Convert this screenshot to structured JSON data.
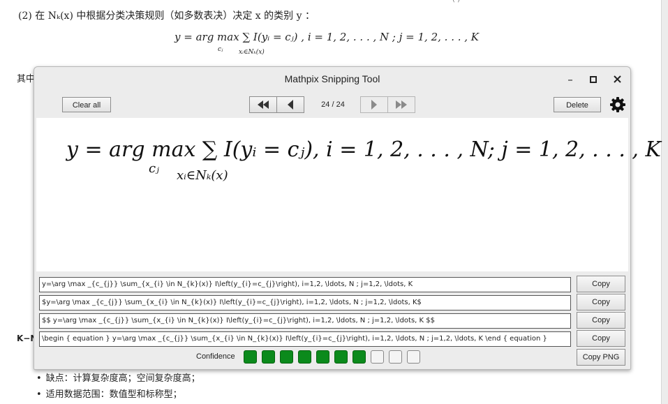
{
  "document": {
    "line1": "(2) 在 Nₖ(x) 中根据分类决策规则（如多数表决）决定 x 的类别 y ：",
    "formula": "y = arg max  ∑  I(yᵢ = cⱼ) ,  i = 1, 2, . . . , N ;  j = 1, 2, . . . , K",
    "formula_sub_c": "cⱼ",
    "formula_sub_sum": "xᵢ∈Nₖ(x)",
    "qizhong": "其中",
    "kn": "K−N",
    "top_fragment": "( )",
    "bullets": [
      "缺点：计算复杂度高；空间复杂度高；",
      "适用数据范围：数值型和标称型；"
    ]
  },
  "window": {
    "title": "Mathpix Snipping Tool",
    "minimize": "–",
    "maximize": "□",
    "close": "✕",
    "clear_all": "Clear all",
    "counter": "24 / 24",
    "delete": "Delete",
    "preview_math": "y = arg max  ∑  I(yᵢ = cⱼ), i = 1, 2, . . . , N; j = 1, 2, . . . , K",
    "preview_sub_c": "cⱼ",
    "preview_sub_sum": "xᵢ∈Nₖ(x)",
    "rows": [
      {
        "latex": "y=\\arg \\max _{c_{j}} \\sum_{x_{i} \\in N_{k}(x)} I\\left(y_{i}=c_{j}\\right), i=1,2, \\ldots, N ; j=1,2, \\ldots, K",
        "copy": "Copy"
      },
      {
        "latex": "$y=\\arg \\max _{c_{j}} \\sum_{x_{i} \\in N_{k}(x)} I\\left(y_{i}=c_{j}\\right), i=1,2, \\ldots, N ; j=1,2, \\ldots, K$",
        "copy": "Copy"
      },
      {
        "latex": "$$ y=\\arg \\max _{c_{j}} \\sum_{x_{i} \\in N_{k}(x)} I\\left(y_{i}=c_{j}\\right), i=1,2, \\ldots, N ; j=1,2, \\ldots, K $$",
        "copy": "Copy"
      },
      {
        "latex": "\\begin { equation } y=\\arg \\max _{c_{j}} \\sum_{x_{i} \\in N_{k}(x)} I\\left(y_{i}=c_{j}\\right), i=1,2, \\ldots, N ; j=1,2, \\ldots, K \\end { equation }",
        "copy": "Copy"
      }
    ],
    "confidence_label": "Confidence",
    "confidence_filled": 7,
    "confidence_total": 10,
    "copy_png": "Copy PNG",
    "colors": {
      "confidence_on": "#0b8a1c",
      "confidence_off": "#f4f4f4"
    }
  }
}
